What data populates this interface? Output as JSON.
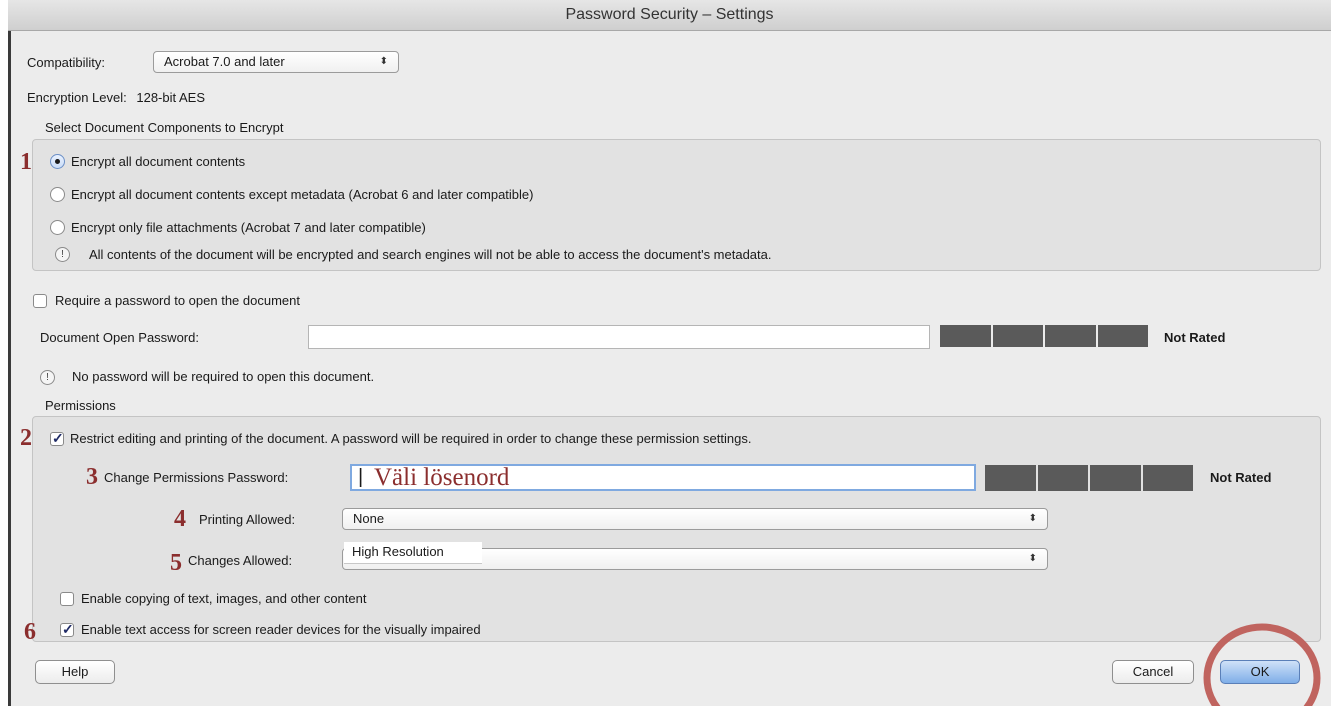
{
  "window": {
    "title": "Password Security – Settings"
  },
  "compatibility": {
    "label": "Compatibility:",
    "value": "Acrobat 7.0 and later"
  },
  "encryption": {
    "label": "Encryption  Level:",
    "value": "128-bit AES"
  },
  "components": {
    "heading": "Select Document Components to Encrypt",
    "options": [
      {
        "label": "Encrypt all document contents",
        "selected": true
      },
      {
        "label": "Encrypt all document contents except metadata (Acrobat 6 and later compatible)",
        "selected": false
      },
      {
        "label": "Encrypt only file attachments (Acrobat 7 and later compatible)",
        "selected": false
      }
    ],
    "notice": "All contents of the document will be encrypted and search engines will not be able to access the document's metadata."
  },
  "open_password": {
    "require_label": "Require a password to open the document",
    "require_checked": false,
    "field_label": "Document Open Password:",
    "value": "",
    "rating": "Not Rated",
    "notice": "No password will be required to open this document."
  },
  "permissions": {
    "heading": "Permissions",
    "restrict_label": "Restrict editing and printing of the document. A password will be required in order to change these permission settings.",
    "restrict_checked": true,
    "password_label": "Change Permissions Password:",
    "password_value": "Väli lösenord",
    "rating": "Not Rated",
    "printing_label": "Printing Allowed:",
    "printing_value": "None",
    "changes_label": "Changes Allowed:",
    "changes_value": "High Resolution",
    "copy_label": "Enable copying of text, images, and other content",
    "copy_checked": false,
    "screen_reader_label": "Enable text access for screen reader devices for the visually impaired",
    "screen_reader_checked": true
  },
  "annotations": {
    "n1": "1",
    "n2": "2",
    "n3": "3",
    "n4": "4",
    "n5": "5",
    "n6": "6"
  },
  "buttons": {
    "help": "Help",
    "cancel": "Cancel",
    "ok": "OK"
  },
  "colors": {
    "annotation": "#8b2e2e",
    "accent": "#7faee8",
    "meter": "#5a5a5a"
  }
}
